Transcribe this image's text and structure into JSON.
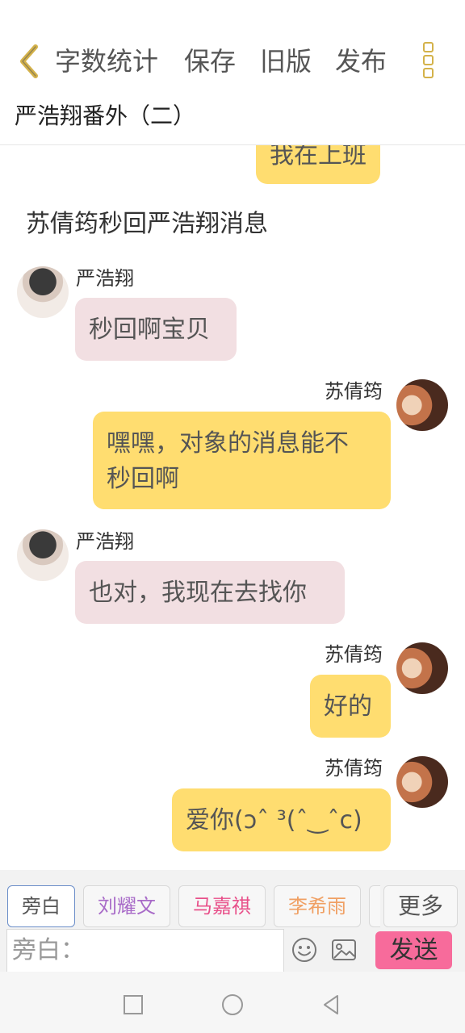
{
  "toolbar": {
    "word_count": "字数统计",
    "save": "保存",
    "old_version": "旧版",
    "publish": "发布"
  },
  "document": {
    "title": "严浩翔番外（二）"
  },
  "chat": {
    "partial_message": "我在上班",
    "narration_1": "苏倩筠秒回严浩翔消息",
    "messages": [
      {
        "sender": "严浩翔",
        "text": "秒回啊宝贝"
      },
      {
        "sender": "苏倩筠",
        "text_line1": "嘿嘿，对象的消息能不",
        "text_line2": "秒回啊"
      },
      {
        "sender": "严浩翔",
        "text": "也对，我现在去找你"
      },
      {
        "sender": "苏倩筠",
        "text": "好的"
      },
      {
        "sender": "苏倩筠",
        "text": "爱你(ɔˆ ³(ˆ‿ˆc)"
      }
    ]
  },
  "characters": {
    "tabs": [
      {
        "label": "旁白",
        "color": "#555555"
      },
      {
        "label": "刘耀文",
        "color": "#a86bc8"
      },
      {
        "label": "马嘉祺",
        "color": "#e8508a"
      },
      {
        "label": "李希雨",
        "color": "#f0a064"
      }
    ],
    "more": "更多"
  },
  "composer": {
    "placeholder": "旁白：",
    "send": "发送"
  },
  "icons": {
    "back": "chevron-left-icon",
    "more": "more-vertical-icon",
    "emoji": "emoji-icon",
    "image": "image-icon",
    "nav_recent": "square-icon",
    "nav_home": "circle-icon",
    "nav_back": "triangle-back-icon"
  },
  "colors": {
    "accent": "#d4b24a",
    "bubble_right": "#ffdd70",
    "bubble_left": "#f2dfe2",
    "send": "#f76b9b"
  }
}
